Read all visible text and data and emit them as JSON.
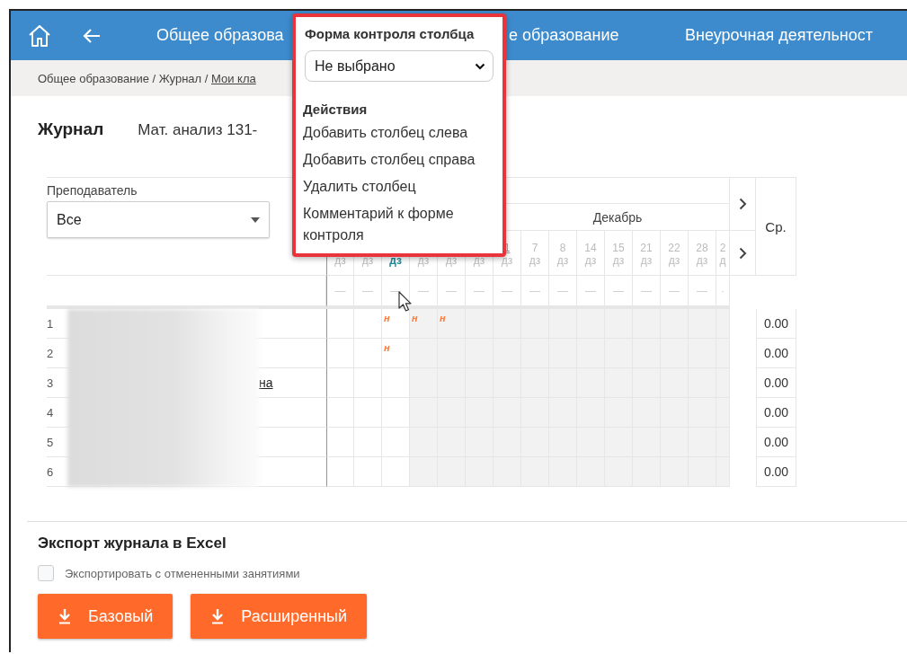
{
  "header": {
    "nav": [
      "Общее образова",
      "е образование",
      "Внеурочная деятельност"
    ]
  },
  "breadcrumbs": {
    "path": "Общее образование / Журнал / ",
    "link": "Мои кла"
  },
  "page": {
    "title": "Журнал",
    "subject": "Мат. анализ 131-"
  },
  "filter": {
    "label": "Преподаватель",
    "value": "Все"
  },
  "table": {
    "month": "Декабрь",
    "avg_header": "Ср.",
    "column_groups": [
      {
        "shaded": false,
        "columns": [
          {
            "type": "дз",
            "selected": false,
            "dash": "—"
          },
          {
            "type": "дз",
            "selected": false,
            "dash": "—"
          },
          {
            "type": "дз",
            "selected": true,
            "dash": "—"
          }
        ]
      },
      {
        "shaded": true,
        "columns": [
          {
            "type": "дз",
            "selected": false,
            "dash": "—"
          },
          {
            "type": "дз",
            "selected": false,
            "dash": "—"
          },
          {
            "type": "дз",
            "selected": false,
            "dash": "—"
          },
          {
            "date": "1",
            "link": true,
            "type": "дз",
            "selected": false,
            "dash": "—"
          },
          {
            "date": "7",
            "link": false,
            "type": "дз",
            "selected": false,
            "dash": "—"
          },
          {
            "date": "8",
            "link": false,
            "type": "дз",
            "selected": false,
            "dash": "—"
          },
          {
            "date": "14",
            "link": false,
            "type": "дз",
            "selected": false,
            "dash": "—"
          },
          {
            "date": "15",
            "link": false,
            "type": "дз",
            "selected": false,
            "dash": "—"
          },
          {
            "date": "21",
            "link": false,
            "type": "дз",
            "selected": false,
            "dash": "—"
          },
          {
            "date": "22",
            "link": false,
            "type": "дз",
            "selected": false,
            "dash": "—"
          },
          {
            "date": "28",
            "link": false,
            "type": "дз",
            "selected": false,
            "dash": "—"
          },
          {
            "date": "2",
            "link": false,
            "type": "д",
            "selected": false,
            "dash": "·"
          }
        ]
      }
    ],
    "rows": [
      {
        "number": "1",
        "cells": [
          {},
          {},
          {
            "mark": "н"
          },
          {
            "mark": "н"
          },
          {
            "mark": "н"
          },
          {},
          {},
          {},
          {},
          {},
          {},
          {},
          {},
          {},
          {}
        ],
        "avg": "0.00"
      },
      {
        "number": "2",
        "cells": [
          {},
          {},
          {
            "mark": "н"
          },
          {},
          {},
          {},
          {},
          {},
          {},
          {},
          {},
          {},
          {},
          {},
          {}
        ],
        "avg": "0.00"
      },
      {
        "number": "3",
        "name": "на",
        "cells": [
          {},
          {},
          {},
          {},
          {},
          {},
          {},
          {},
          {},
          {},
          {},
          {},
          {},
          {},
          {}
        ],
        "avg": "0.00"
      },
      {
        "number": "4",
        "cells": [
          {},
          {},
          {},
          {},
          {},
          {},
          {},
          {},
          {},
          {},
          {},
          {},
          {},
          {},
          {}
        ],
        "avg": "0.00"
      },
      {
        "number": "5",
        "cells": [
          {},
          {},
          {},
          {},
          {},
          {},
          {},
          {},
          {},
          {},
          {},
          {},
          {},
          {},
          {}
        ],
        "avg": "0.00"
      },
      {
        "number": "6",
        "cells": [
          {},
          {},
          {},
          {},
          {},
          {},
          {},
          {},
          {},
          {},
          {},
          {},
          {},
          {},
          {}
        ],
        "avg": "0.00"
      }
    ]
  },
  "export": {
    "title": "Экспорт журнала в Excel",
    "option": {
      "label": "Экспортировать с отмененными занятиями",
      "checked": false
    },
    "buttons": [
      "Базовый",
      "Расширенный"
    ]
  },
  "popup": {
    "title": "Форма контроля столбца",
    "select": "Не выбрано",
    "actions_title": "Действия",
    "actions": [
      "Добавить столбец слева",
      "Добавить столбец справа",
      "Удалить столбец",
      "Комментарий к форме контроля"
    ]
  }
}
